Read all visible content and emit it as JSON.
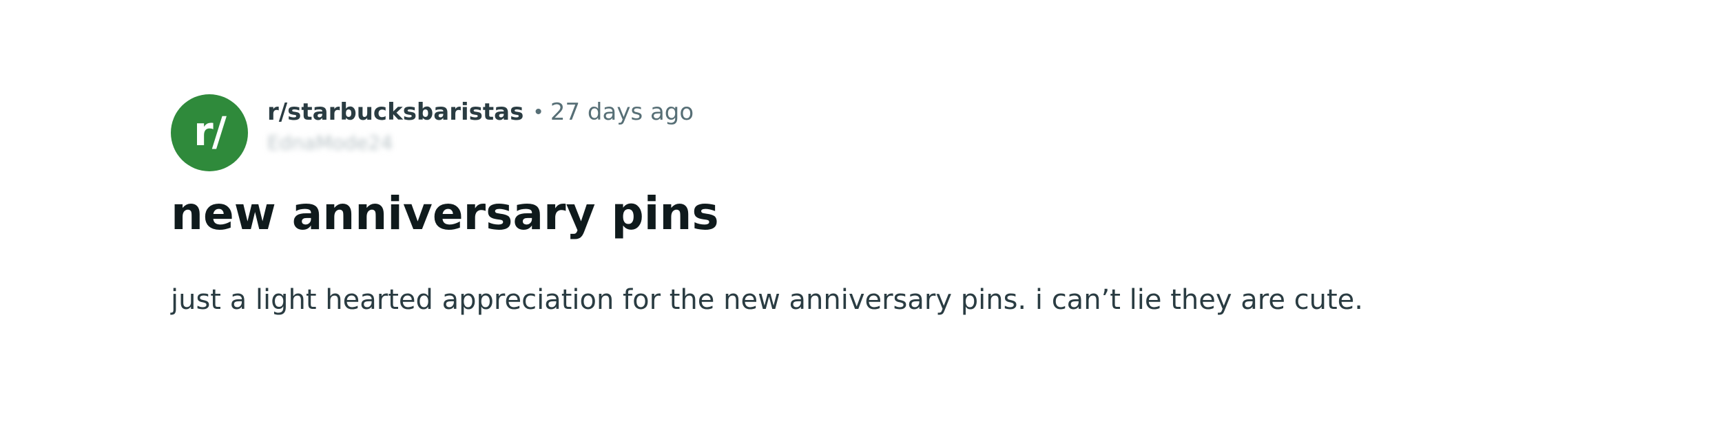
{
  "post": {
    "subreddit_icon_text": "r/",
    "subreddit": "r/starbucksbaristas",
    "separator": "•",
    "time_ago": "27 days ago",
    "author": "EdnaMode24",
    "title": "new anniversary pins",
    "body": "just a light hearted appreciation for the new anniversary pins. i can’t lie they are cute."
  },
  "colors": {
    "avatar_bg": "#2f8a3b",
    "title": "#0f1a1c",
    "meta": "#576f76"
  }
}
